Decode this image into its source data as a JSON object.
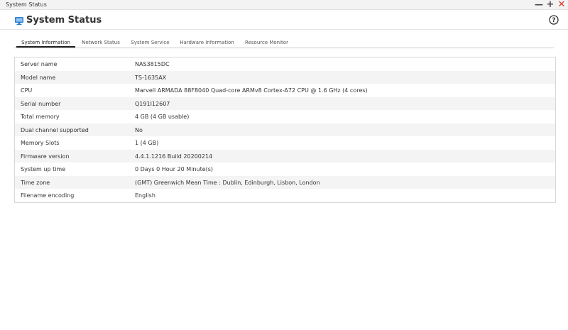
{
  "window": {
    "title": "System Status",
    "controls": {
      "minimize": "—",
      "maximize": "+",
      "close": "✕"
    }
  },
  "header": {
    "title": "System Status",
    "icon": "monitor-icon",
    "help_icon": "help-icon"
  },
  "tabs": [
    {
      "label": "System Information",
      "active": true
    },
    {
      "label": "Network Status",
      "active": false
    },
    {
      "label": "System Service",
      "active": false
    },
    {
      "label": "Hardware Information",
      "active": false
    },
    {
      "label": "Resource Monitor",
      "active": false
    }
  ],
  "system_info": [
    {
      "label": "Server name",
      "value": "NAS3815DC"
    },
    {
      "label": "Model name",
      "value": "TS-1635AX"
    },
    {
      "label": "CPU",
      "value": "Marvell ARMADA 88F8040 Quad-core ARMv8 Cortex-A72 CPU @ 1.6 GHz (4 cores)"
    },
    {
      "label": "Serial number",
      "value": "Q191I12607"
    },
    {
      "label": "Total memory",
      "value": "4 GB (4 GB usable)"
    },
    {
      "label": "Dual channel supported",
      "value": "No"
    },
    {
      "label": "Memory Slots",
      "value": "1 (4 GB)"
    },
    {
      "label": "Firmware version",
      "value": "4.4.1.1216 Build 20200214"
    },
    {
      "label": "System up time",
      "value": "0 Days 0 Hour 20 Minute(s)"
    },
    {
      "label": "Time zone",
      "value": "(GMT) Greenwich Mean Time : Dublin, Edinburgh, Lisbon, London"
    },
    {
      "label": "Filename encoding",
      "value": "English"
    }
  ],
  "colors": {
    "close": "#e0312b",
    "icon_blue": "#2f7fd0",
    "alt_row": "#f4f4f4"
  }
}
